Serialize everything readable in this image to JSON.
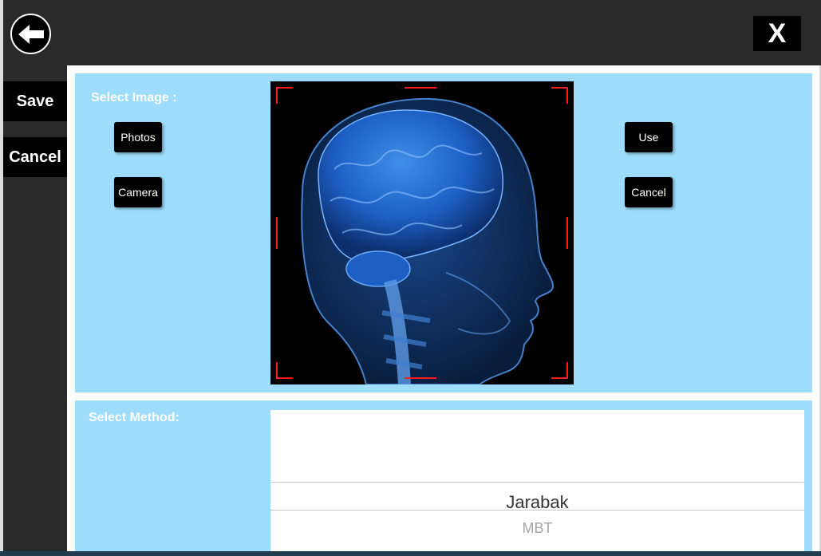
{
  "header": {
    "back_icon": "arrow-left-icon",
    "close_label": "X"
  },
  "sidebar": {
    "save_label": "Save",
    "cancel_label": "Cancel"
  },
  "image_section": {
    "title": "Select Image :",
    "photos_label": "Photos",
    "camera_label": "Camera",
    "use_label": "Use",
    "cancel_label": "Cancel",
    "image_subject": "x-ray head brain scan",
    "crop_marker_color": "#ff1a1a"
  },
  "method_section": {
    "title": "Select Method:",
    "options": [
      "Jarabak",
      "MBT"
    ],
    "selected": "Jarabak"
  },
  "colors": {
    "panel_bg": "#9ddcfb",
    "chrome_bg": "#2a2a2a",
    "button_bg": "#000000"
  }
}
